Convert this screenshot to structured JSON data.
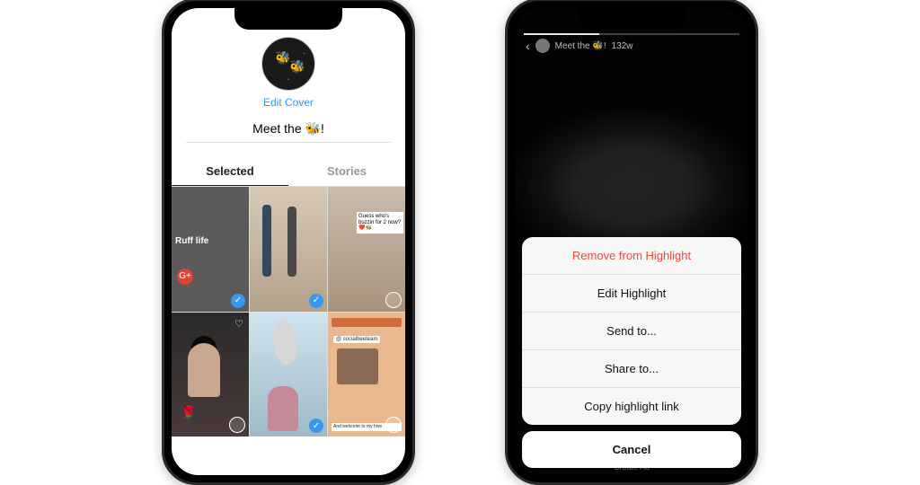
{
  "edit_screen": {
    "edit_cover_label": "Edit Cover",
    "title_value": "Meet the 🐝!",
    "tabs": {
      "selected": "Selected",
      "stories": "Stories"
    },
    "thumbs": [
      {
        "caption": "Ruff life",
        "badge": "G+",
        "selected": true
      },
      {
        "caption": "",
        "selected": true
      },
      {
        "caption": "Guess who's buzzin for 2 now? ❤️🐝",
        "selected": false
      },
      {
        "caption": "",
        "selected": false
      },
      {
        "caption": "",
        "selected": true
      },
      {
        "handle": "@ socialbeeteam",
        "caption": "And welcome to my hive",
        "selected": false
      }
    ]
  },
  "story_screen": {
    "header": {
      "title": "Meet the 🐝!",
      "age": "132w"
    },
    "footer_hint": "Create Ad",
    "sheet": {
      "remove": "Remove from Highlight",
      "edit": "Edit Highlight",
      "send": "Send to...",
      "share": "Share to...",
      "copy": "Copy highlight link",
      "cancel": "Cancel"
    }
  }
}
